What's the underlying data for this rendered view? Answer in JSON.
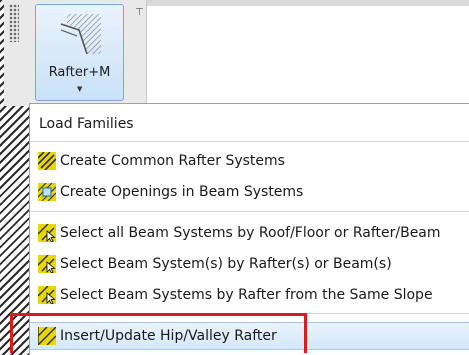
{
  "ribbon": {
    "button_label": "Rafter+M",
    "button_icon": "rafter-hatch-icon"
  },
  "menu": {
    "items": [
      {
        "label": "Load Families",
        "icon": ""
      },
      {
        "label": "Create Common Rafter Systems",
        "icon": "rafter-system-icon"
      },
      {
        "label": "Create Openings in Beam Systems",
        "icon": "opening-icon"
      },
      {
        "label": "Select all Beam Systems by Roof/Floor or Rafter/Beam",
        "icon": "select-beam-icon"
      },
      {
        "label": "Select Beam System(s) by Rafter(s) or Beam(s)",
        "icon": "select-beam-icon"
      },
      {
        "label": "Select Beam Systems by Rafter from the Same Slope",
        "icon": "select-beam-icon"
      },
      {
        "label": "Insert/Update Hip/Valley Rafter",
        "icon": "hip-valley-icon"
      }
    ]
  },
  "colors": {
    "highlight": "#d6e8fb",
    "callout": "#e01a1a",
    "icon_yellow": "#e6d800"
  }
}
